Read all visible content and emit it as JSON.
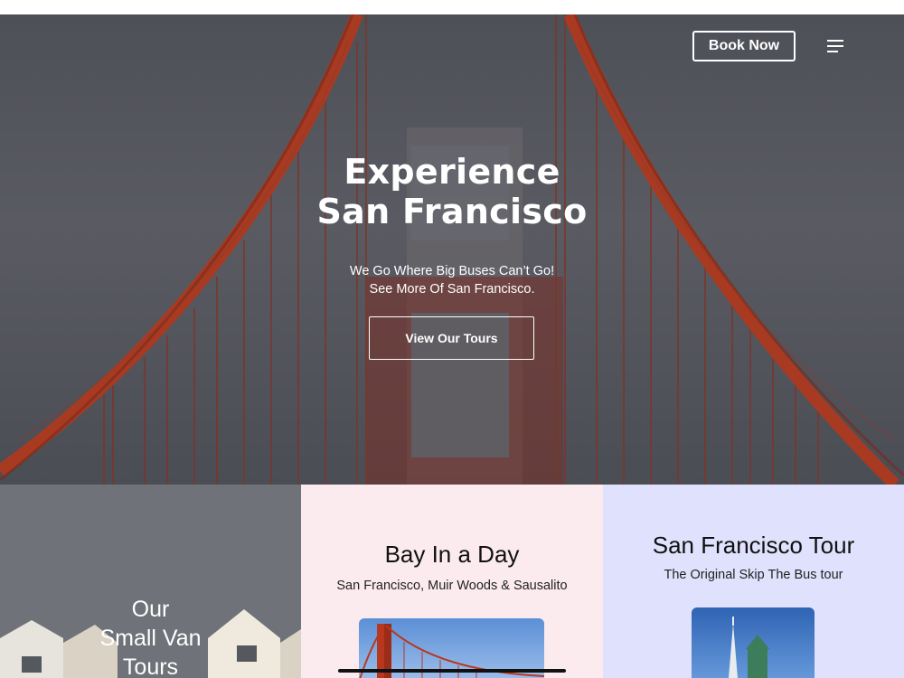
{
  "header": {
    "book_label": "Book Now",
    "menu_icon": "hamburger-menu-icon"
  },
  "hero": {
    "title_line1": "Experience",
    "title_line2": "San Francisco",
    "subtitle_line1": "We Go Where Big Buses Can’t Go!",
    "subtitle_line2": "See More Of San Francisco.",
    "cta_label": "View Our Tours",
    "background_image": "golden-gate-bridge-photo"
  },
  "cards": [
    {
      "title_line1": "Our",
      "title_line2": "Small Van",
      "title_line3": "Tours",
      "image": "painted-ladies-houses-photo"
    },
    {
      "title": "Bay In a Day",
      "subtitle": "San Francisco, Muir Woods & Sausalito",
      "image": "golden-gate-bridge-thumbnail"
    },
    {
      "title": "San Francisco Tour",
      "subtitle": "The Original Skip The Bus tour",
      "image": "transamerica-pyramid-thumbnail"
    }
  ],
  "colors": {
    "card1_bg": "#6b6f77",
    "card2_bg": "#fcebee",
    "card3_bg": "#e0e2fd",
    "bridge_red": "#a83a22"
  }
}
